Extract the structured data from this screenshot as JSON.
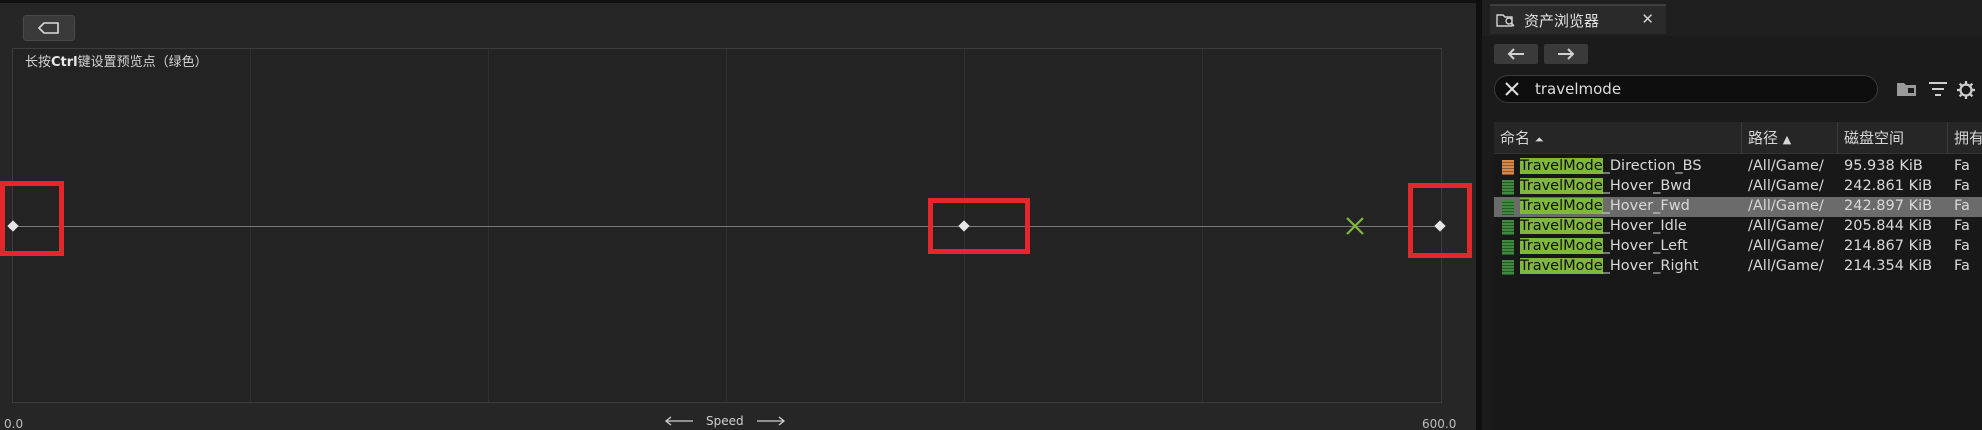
{
  "editor": {
    "hint_prefix": "长按",
    "hint_key": "Ctrl",
    "hint_suffix": "键设置预览点（绿色）",
    "axis_min": "0.0",
    "axis_max": "600.0",
    "axis_name": "Speed"
  },
  "browser": {
    "tab_title": "资产浏览器",
    "search_value": "travelmode",
    "columns": [
      "命名",
      "路径",
      "磁盘空间",
      "拥有"
    ],
    "match_text": "TravelMode",
    "rows": [
      {
        "suffix": "_Direction_BS",
        "path": "/All/Game/",
        "size": "95.938 KiB",
        "owner": "Fa",
        "type": "blendspace",
        "selected": false
      },
      {
        "suffix": "_Hover_Bwd",
        "path": "/All/Game/",
        "size": "242.861 KiB",
        "owner": "Fa",
        "type": "animsequence",
        "selected": false
      },
      {
        "suffix": "_Hover_Fwd",
        "path": "/All/Game/",
        "size": "242.897 KiB",
        "owner": "Fa",
        "type": "animsequence",
        "selected": true
      },
      {
        "suffix": "_Hover_Idle",
        "path": "/All/Game/",
        "size": "205.844 KiB",
        "owner": "Fa",
        "type": "animsequence",
        "selected": false
      },
      {
        "suffix": "_Hover_Left",
        "path": "/All/Game/",
        "size": "214.867 KiB",
        "owner": "Fa",
        "type": "animsequence",
        "selected": false
      },
      {
        "suffix": "_Hover_Right",
        "path": "/All/Game/",
        "size": "214.354 KiB",
        "owner": "Fa",
        "type": "animsequence",
        "selected": false
      }
    ]
  },
  "colors": {
    "highlight_box": "#e5272d",
    "preview_point": "#7fb83a",
    "search_match": "#7fb83a",
    "blendspace_icon": "#d88a4a",
    "animsequence_icon": "#3e8a3e"
  }
}
